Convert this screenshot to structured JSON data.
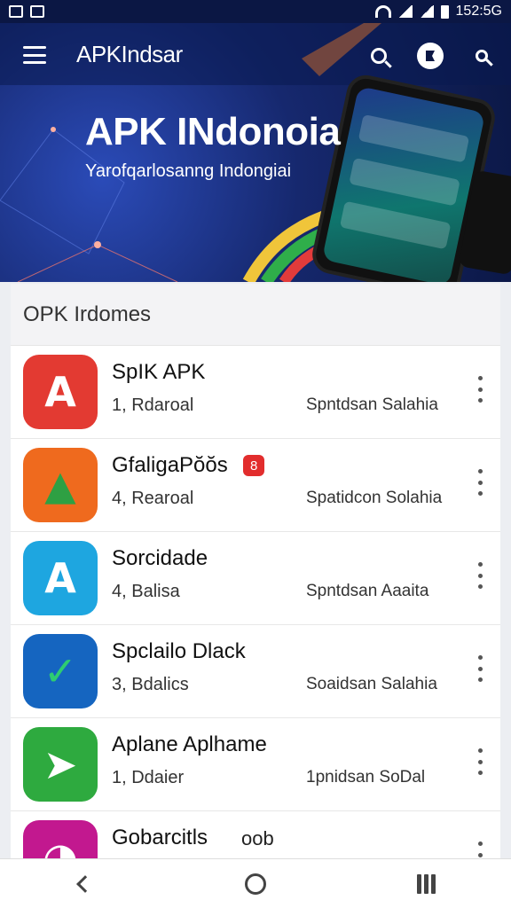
{
  "status_bar": {
    "time": "152:5G"
  },
  "header": {
    "app_title": "APKIndsar",
    "headline": "APK INdonoia",
    "subline": "Yarofqarlosanng Indongiai"
  },
  "section": {
    "title": "OPK Irdomes"
  },
  "apps": [
    {
      "name": "SpIK APK",
      "meta": "1, Rdaroal",
      "source": "Spntdsan Salahia",
      "badge": "",
      "icon_color": "#e33a32",
      "icon_glyph": "A",
      "icon": "app-icon-red"
    },
    {
      "name": "GfaligaPŏŏs",
      "meta": "4,  Rearoal",
      "source": "Spatidcon Solahia",
      "badge": "8",
      "icon_color": "#ef6a1e",
      "icon_glyph": "▲",
      "icon": "app-icon-orange"
    },
    {
      "name": "Sorcidade",
      "meta": "4,  Balisa",
      "source": "Spntdsan Aaaita",
      "badge": "",
      "icon_color": "#1ea6e0",
      "icon_glyph": "A",
      "icon": "app-icon-blue"
    },
    {
      "name": "Spclailo Dlack",
      "meta": "3, Bdalics",
      "source": "Soaidsan Salahia",
      "badge": "",
      "icon_color": "#1565c0",
      "icon_glyph": "✓",
      "icon": "app-icon-darkblue"
    },
    {
      "name": "Aplane Aplhame",
      "meta": "1, Ddaier",
      "source": "1pnidsan SoDal",
      "badge": "",
      "icon_color": "#2eaa3f",
      "icon_glyph": "➤",
      "icon": "app-icon-green"
    },
    {
      "name": "Gobarcitls",
      "meta": "",
      "source": "",
      "badge_plain": "oob",
      "icon_color": "#c2188f",
      "icon_glyph": "◔",
      "icon": "app-icon-magenta"
    }
  ]
}
